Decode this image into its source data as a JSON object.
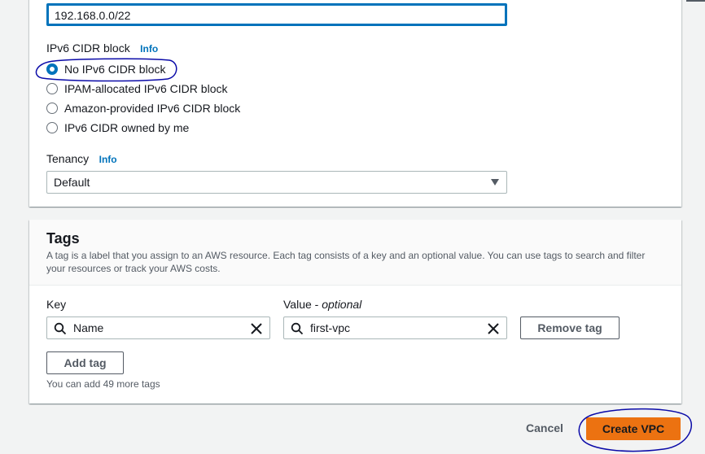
{
  "network": {
    "ipv4_cidr_value": "192.168.0.0/22",
    "ipv6_label": "IPv6 CIDR block",
    "info_label": "Info",
    "ipv6_options": [
      {
        "label": "No IPv6 CIDR block",
        "selected": true
      },
      {
        "label": "IPAM-allocated IPv6 CIDR block",
        "selected": false
      },
      {
        "label": "Amazon-provided IPv6 CIDR block",
        "selected": false
      },
      {
        "label": "IPv6 CIDR owned by me",
        "selected": false
      }
    ],
    "tenancy_label": "Tenancy",
    "tenancy_value": "Default"
  },
  "tags": {
    "title": "Tags",
    "description": "A tag is a label that you assign to an AWS resource. Each tag consists of a key and an optional value. You can use tags to search and filter your resources or track your AWS costs.",
    "key_label": "Key",
    "value_label": "Value",
    "value_optional": "optional",
    "value_separator": " - ",
    "rows": [
      {
        "key": "Name",
        "value": "first-vpc"
      }
    ],
    "remove_tag_label": "Remove tag",
    "add_tag_label": "Add tag",
    "remaining_hint": "You can add 49 more tags"
  },
  "footer": {
    "cancel_label": "Cancel",
    "create_label": "Create VPC"
  },
  "colors": {
    "accent_blue": "#0073bb",
    "primary_orange": "#ec7211",
    "annotation_ink": "#0a0aa8"
  }
}
